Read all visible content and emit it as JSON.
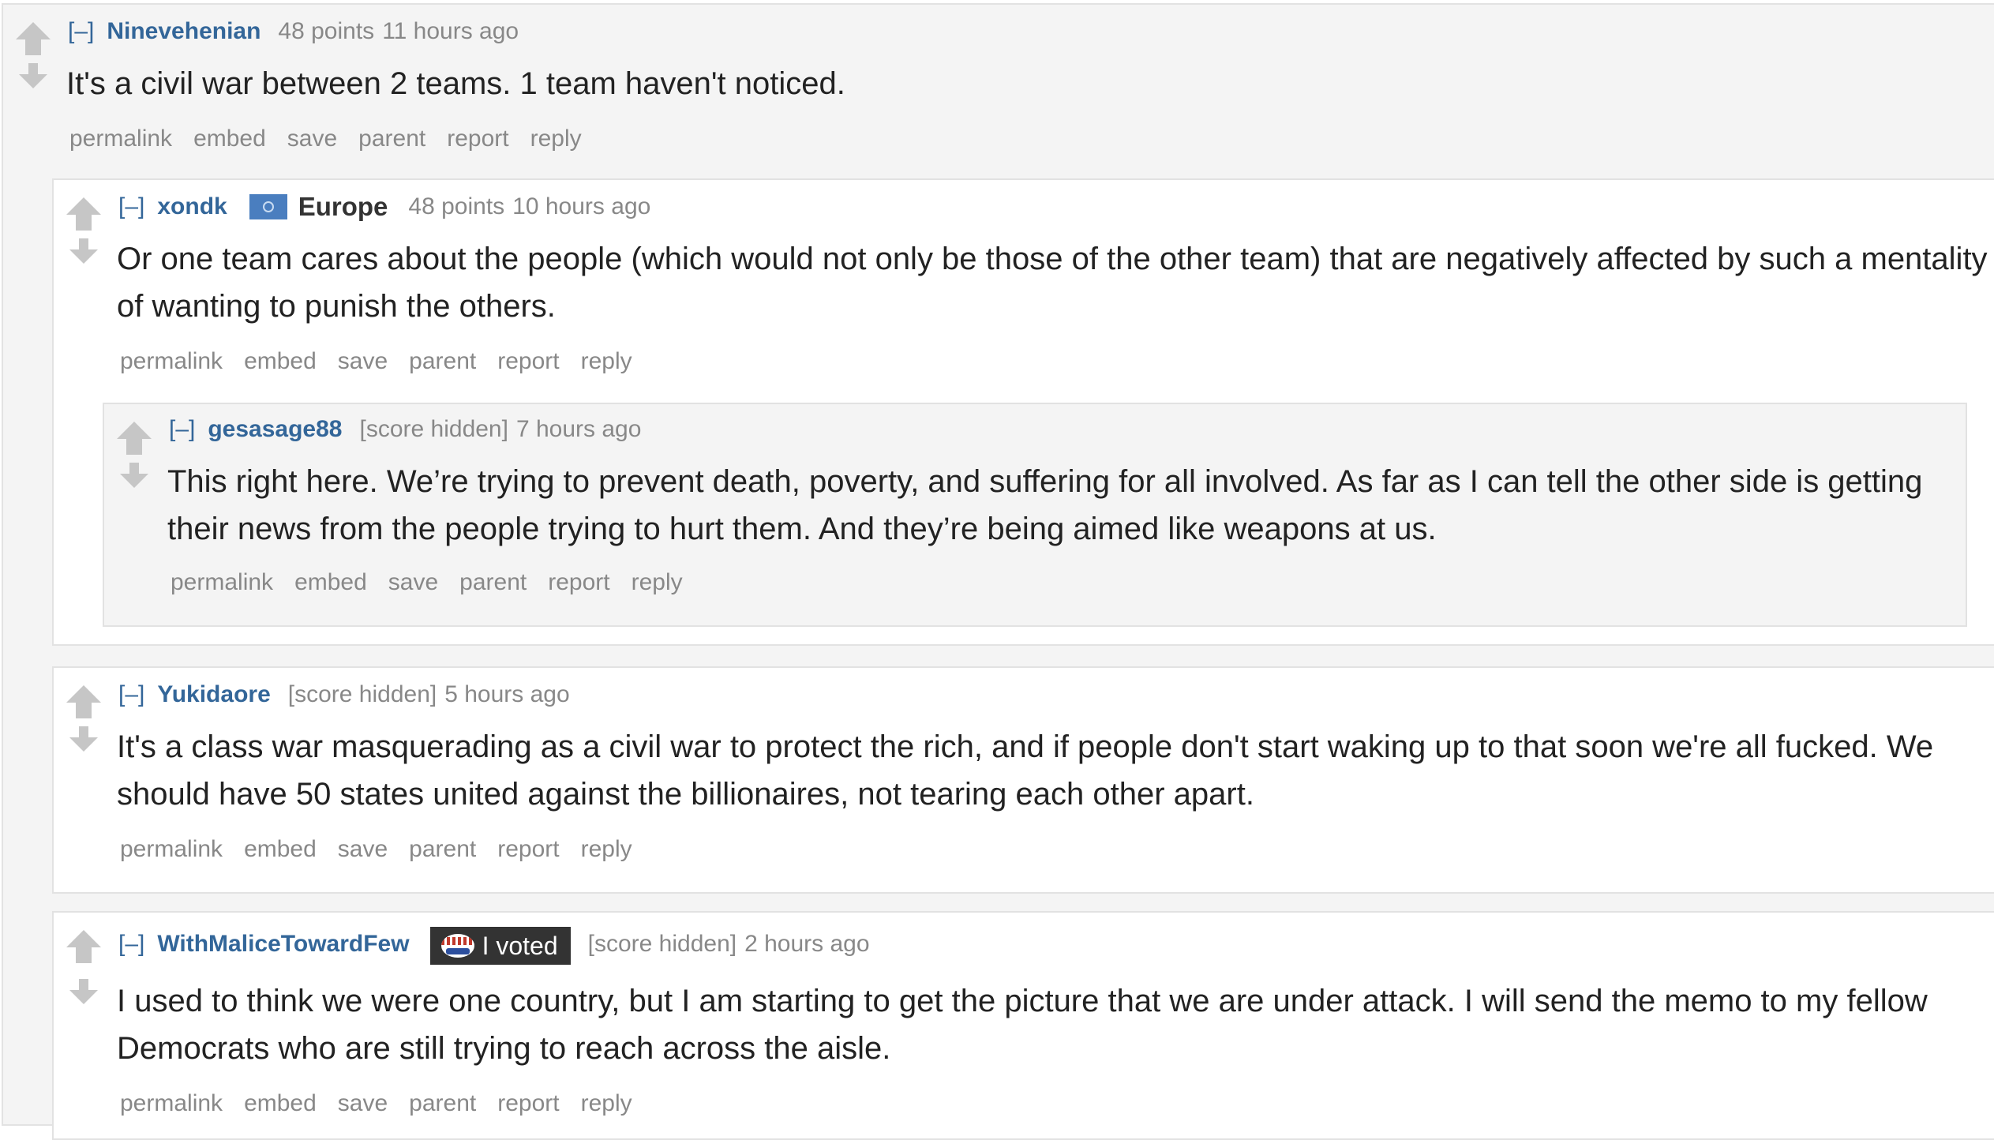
{
  "expand_label": "[–]",
  "action_buttons": [
    "permalink",
    "embed",
    "save",
    "parent",
    "report",
    "reply"
  ],
  "colors": {
    "author_link": "#336699",
    "meta_text": "#888888",
    "body_text": "#222222",
    "arrow": "#c6c6c6",
    "nested_bg_gray": "#f4f4f4",
    "nested_bg_white": "#ffffff",
    "flair_dark": "#333333"
  },
  "comments": [
    {
      "author": "Ninevehenian",
      "score": "48 points",
      "time": "11 hours ago",
      "body": "It's a civil war between 2 teams. 1 team haven't noticed."
    },
    {
      "author": "xondk",
      "flair": {
        "icon": "un-flag-icon",
        "text": "Europe"
      },
      "score": "48 points",
      "time": "10 hours ago",
      "body": "Or one team cares about the people (which would not only be those of the other team) that are negatively affected by such a mentality of wanting to punish the others."
    },
    {
      "author": "gesasage88",
      "score": "[score hidden]",
      "time": "7 hours ago",
      "body": "This right here. We’re trying to prevent death, poverty, and suffering for all involved. As far as I can tell the other side is getting their news from the people trying to hurt them. And they’re being aimed like weapons at us."
    },
    {
      "author": "Yukidaore",
      "score": "[score hidden]",
      "time": "5 hours ago",
      "body": "It's a class war masquerading as a civil war to protect the rich, and if people don't start waking up to that soon we're all fucked. We should have 50 states united against the billionaires, not tearing each other apart."
    },
    {
      "author": "WithMaliceTowardFew",
      "flair": {
        "icon": "i-voted-sticker-icon",
        "text": "I voted"
      },
      "score": "[score hidden]",
      "time": "2 hours ago",
      "body": "I used to think we were one country, but I am starting to get the picture that we are under attack. I will send the memo to my fellow Democrats who are still trying to reach across the aisle."
    }
  ]
}
